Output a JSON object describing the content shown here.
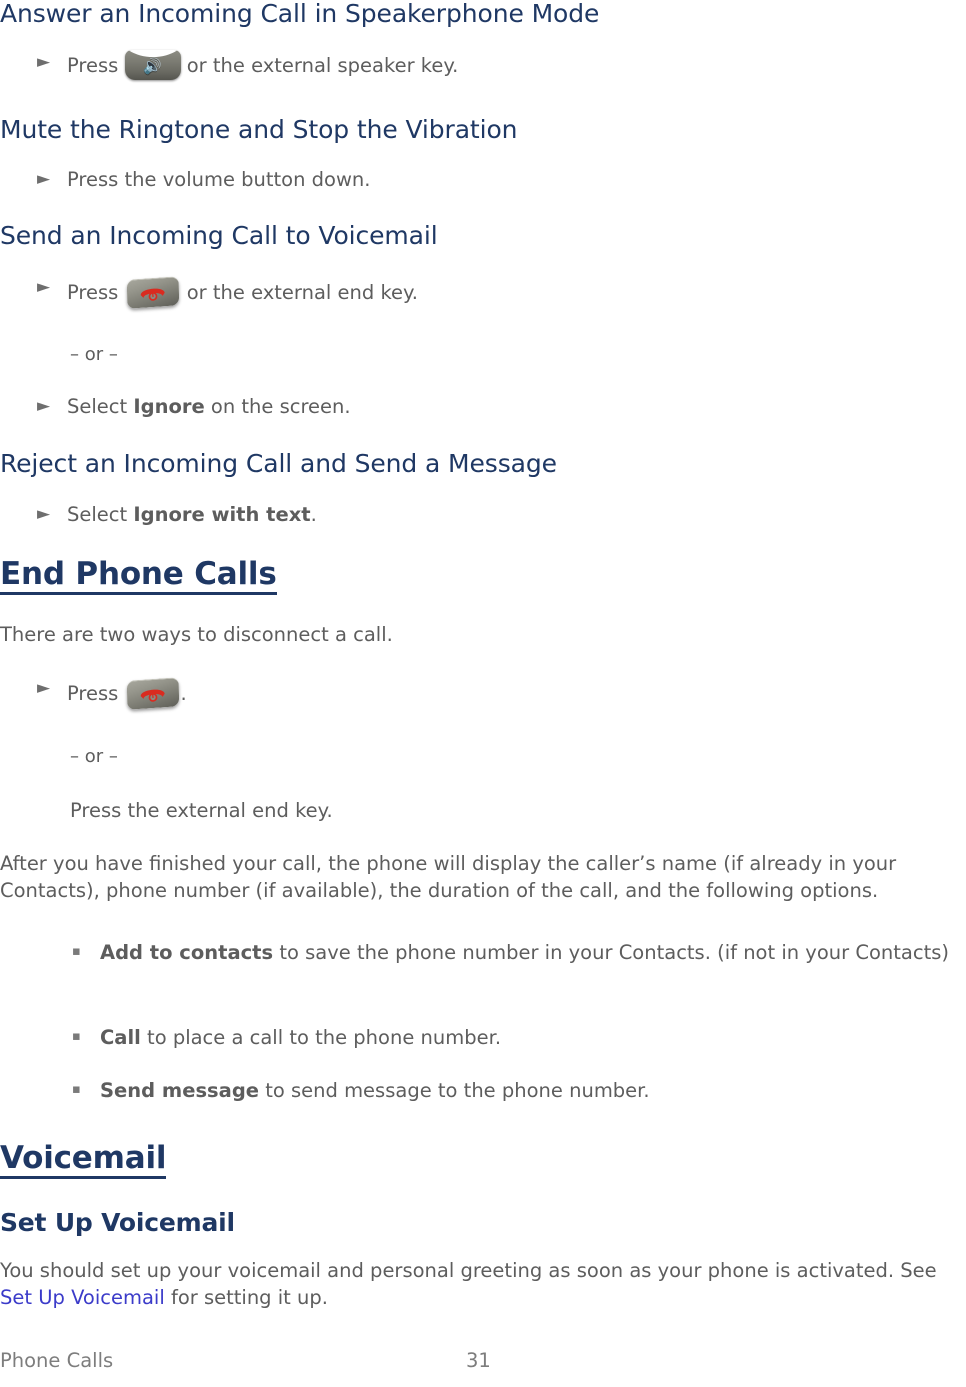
{
  "document": {
    "sections": [
      {
        "id": "answer-speakerphone",
        "heading": "Answer an Incoming Call in Speakerphone Mode",
        "bullets": [
          {
            "pre": "Press ",
            "icon": "speaker-key-icon",
            "post": " or the external speaker key."
          }
        ]
      },
      {
        "id": "mute-ringtone",
        "heading": "Mute the Ringtone and Stop the Vibration",
        "bullets": [
          {
            "pre": "Press the volume button down.",
            "icon": null,
            "post": ""
          }
        ]
      },
      {
        "id": "send-to-voicemail",
        "heading": "Send an Incoming Call to Voicemail",
        "bullets": [
          {
            "pre": "Press ",
            "icon": "end-key-icon",
            "post": " or the external end key."
          }
        ],
        "or_text": "– or –",
        "bullets2": [
          {
            "pre": "Select ",
            "bold": "Ignore",
            "post": " on the screen."
          }
        ]
      },
      {
        "id": "reject-send-message",
        "heading": "Reject an Incoming Call and Send a Message",
        "bullets": [
          {
            "pre": "Select ",
            "bold": "Ignore with text",
            "post": "."
          }
        ]
      }
    ],
    "end_phone_calls": {
      "heading": "End Phone Calls",
      "intro": "There are two ways to disconnect a call.",
      "bullet": {
        "pre": "Press ",
        "icon": "end-key-icon",
        "post": "."
      },
      "or_text": "– or –",
      "alt_text": "Press the external end key.",
      "after_paragraph": "After you have finished your call, the phone will display the caller’s name (if already in your Contacts), phone number (if available), the duration of the call, and the following options.",
      "options": [
        {
          "bold": "Add to contacts",
          "rest": " to save the phone number in your Contacts. (if not in your Contacts)"
        },
        {
          "bold": "Call",
          "rest": " to place a call to the phone number."
        },
        {
          "bold": "Send message",
          "rest": " to send message to the phone number."
        }
      ]
    },
    "voicemail": {
      "heading": "Voicemail",
      "subheading": "Set Up Voicemail",
      "body_before_link": "You should set up your voicemail and personal greeting as soon as your phone is activated. See ",
      "link_text": "Set Up Voicemail",
      "body_after_link": " for setting it up."
    },
    "footer": {
      "left_label": "Phone Calls",
      "page_number": "31"
    },
    "colors": {
      "heading": "#1f3864",
      "body": "#5d5d5d",
      "link": "#3b3bc9",
      "marker": "#6e6e6e",
      "key_red": "#d92b20"
    }
  }
}
